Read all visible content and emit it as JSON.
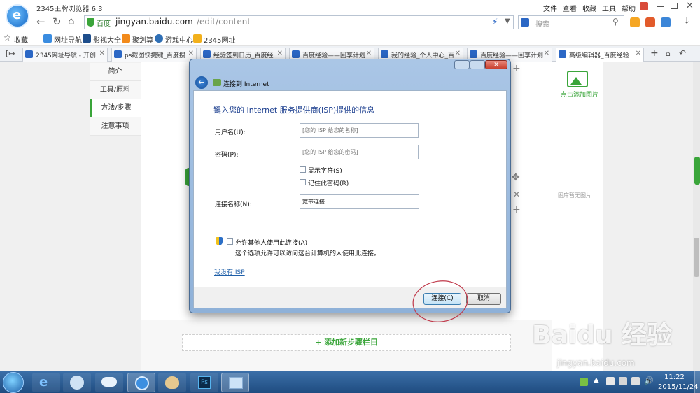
{
  "browser": {
    "title": "2345王牌浏览器 6.3",
    "menu": [
      "文件",
      "查看",
      "收藏",
      "工具",
      "帮助"
    ],
    "site_badge": "百度",
    "url_host": "jingyan.baidu.com",
    "url_path": "/edit/content",
    "search_placeholder": "搜索"
  },
  "favorites": {
    "label": "收藏",
    "items": [
      "网址导航",
      "影视大全",
      "聚划算",
      "游戏中心",
      "2345网址"
    ]
  },
  "tabs": [
    {
      "label": "2345网址导航 - 开创"
    },
    {
      "label": "ps截图快捷键_百度搜"
    },
    {
      "label": "经验签到日历_百度经"
    },
    {
      "label": "百度经验——回享计划"
    },
    {
      "label": "我的经验_个人中心_百"
    },
    {
      "label": "百度经验——回享计划"
    },
    {
      "label": "高级编辑器_百度经验"
    }
  ],
  "sidebar": {
    "items": [
      "简介",
      "工具/原料",
      "方法/步骤",
      "注意事项"
    ]
  },
  "editor": {
    "add_step": "+ 添加新步骤栏目",
    "add_image": "点击添加图片",
    "no_image": "图库暂无图片"
  },
  "dialog": {
    "title": "连接到 Internet",
    "heading": "键入您的 Internet 服务提供商(ISP)提供的信息",
    "username_label": "用户名(U):",
    "username_placeholder": "[您的 ISP 给您的名称]",
    "password_label": "密码(P):",
    "password_placeholder": "[您的 ISP 给您的密码]",
    "show_chars": "显示字符(S)",
    "remember_pwd": "记住此密码(R)",
    "conn_name_label": "连接名称(N):",
    "conn_name_value": "宽带连接",
    "allow_others": "允许其他人使用此连接(A)",
    "allow_note": "这个选项允许可以访问这台计算机的人使用此连接。",
    "no_isp_link": "我没有 ISP",
    "connect_btn": "连接(C)",
    "cancel_btn": "取消"
  },
  "watermark": {
    "line1": "Baidu 经验",
    "line2": "jingyan.baidu.com"
  },
  "clock": {
    "time": "11:22",
    "date": "2015/11/24"
  },
  "colors": {
    "accent_green": "#3aa53a",
    "dialog_blue": "#1c3f8f",
    "link_blue": "#1f5fa8",
    "annotation_red": "#c0394a"
  }
}
